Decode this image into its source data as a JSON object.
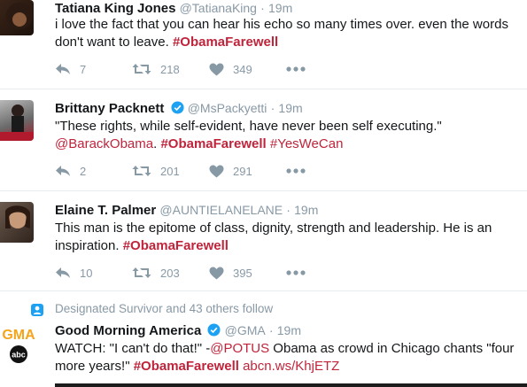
{
  "tweets": [
    {
      "name": "Tatiana King Jones",
      "handle": "@TatianaKing",
      "time": "19m",
      "text": [
        {
          "t": "i love the fact that you can hear his echo so many times over. even the words don't want to leave. ",
          "k": "plain"
        },
        {
          "t": "#ObamaFarewell",
          "k": "ht"
        }
      ],
      "replies": "7",
      "retweets": "218",
      "likes": "349"
    },
    {
      "name": "Brittany Packnett",
      "handle": "@MsPackyetti",
      "time": "19m",
      "verified": true,
      "text": [
        {
          "t": "\"These rights, while self-evident, have never been self executing.\" ",
          "k": "plain"
        },
        {
          "t": "@BarackObama",
          "k": "mention"
        },
        {
          "t": ". ",
          "k": "plain"
        },
        {
          "t": "#ObamaFarewell",
          "k": "ht"
        },
        {
          "t": " ",
          "k": "plain"
        },
        {
          "t": "#YesWeCan",
          "k": "mention"
        }
      ],
      "replies": "2",
      "retweets": "201",
      "likes": "291"
    },
    {
      "name": "Elaine T. Palmer",
      "handle": "@AUNTIELANELANE",
      "time": "19m",
      "text": [
        {
          "t": "This man is the epitome of class, dignity, strength and leadership. He is an inspiration. ",
          "k": "plain"
        },
        {
          "t": "#ObamaFarewell",
          "k": "ht"
        }
      ],
      "replies": "10",
      "retweets": "203",
      "likes": "395"
    },
    {
      "social_context": "Designated Survivor and 43 others follow",
      "name": "Good Morning America",
      "handle": "@GMA",
      "time": "19m",
      "verified": true,
      "logo_text": "GMA",
      "logo_sub": "abc",
      "text": [
        {
          "t": "WATCH: \"I can't do that!\" -",
          "k": "plain"
        },
        {
          "t": "@POTUS",
          "k": "mention"
        },
        {
          "t": " Obama as crowd in Chicago chants \"four more years!\" ",
          "k": "plain"
        },
        {
          "t": "#ObamaFarewell",
          "k": "ht"
        },
        {
          "t": " ",
          "k": "plain"
        },
        {
          "t": "abcn.ws/KhjETZ",
          "k": "link"
        }
      ]
    }
  ],
  "colors": {
    "hashtag": "#c0243b",
    "muted": "#8899a6",
    "verified": "#1da1f2"
  },
  "icons": {
    "reply": "reply-icon",
    "retweet": "retweet-icon",
    "like": "heart-icon",
    "more": "more-icon"
  }
}
